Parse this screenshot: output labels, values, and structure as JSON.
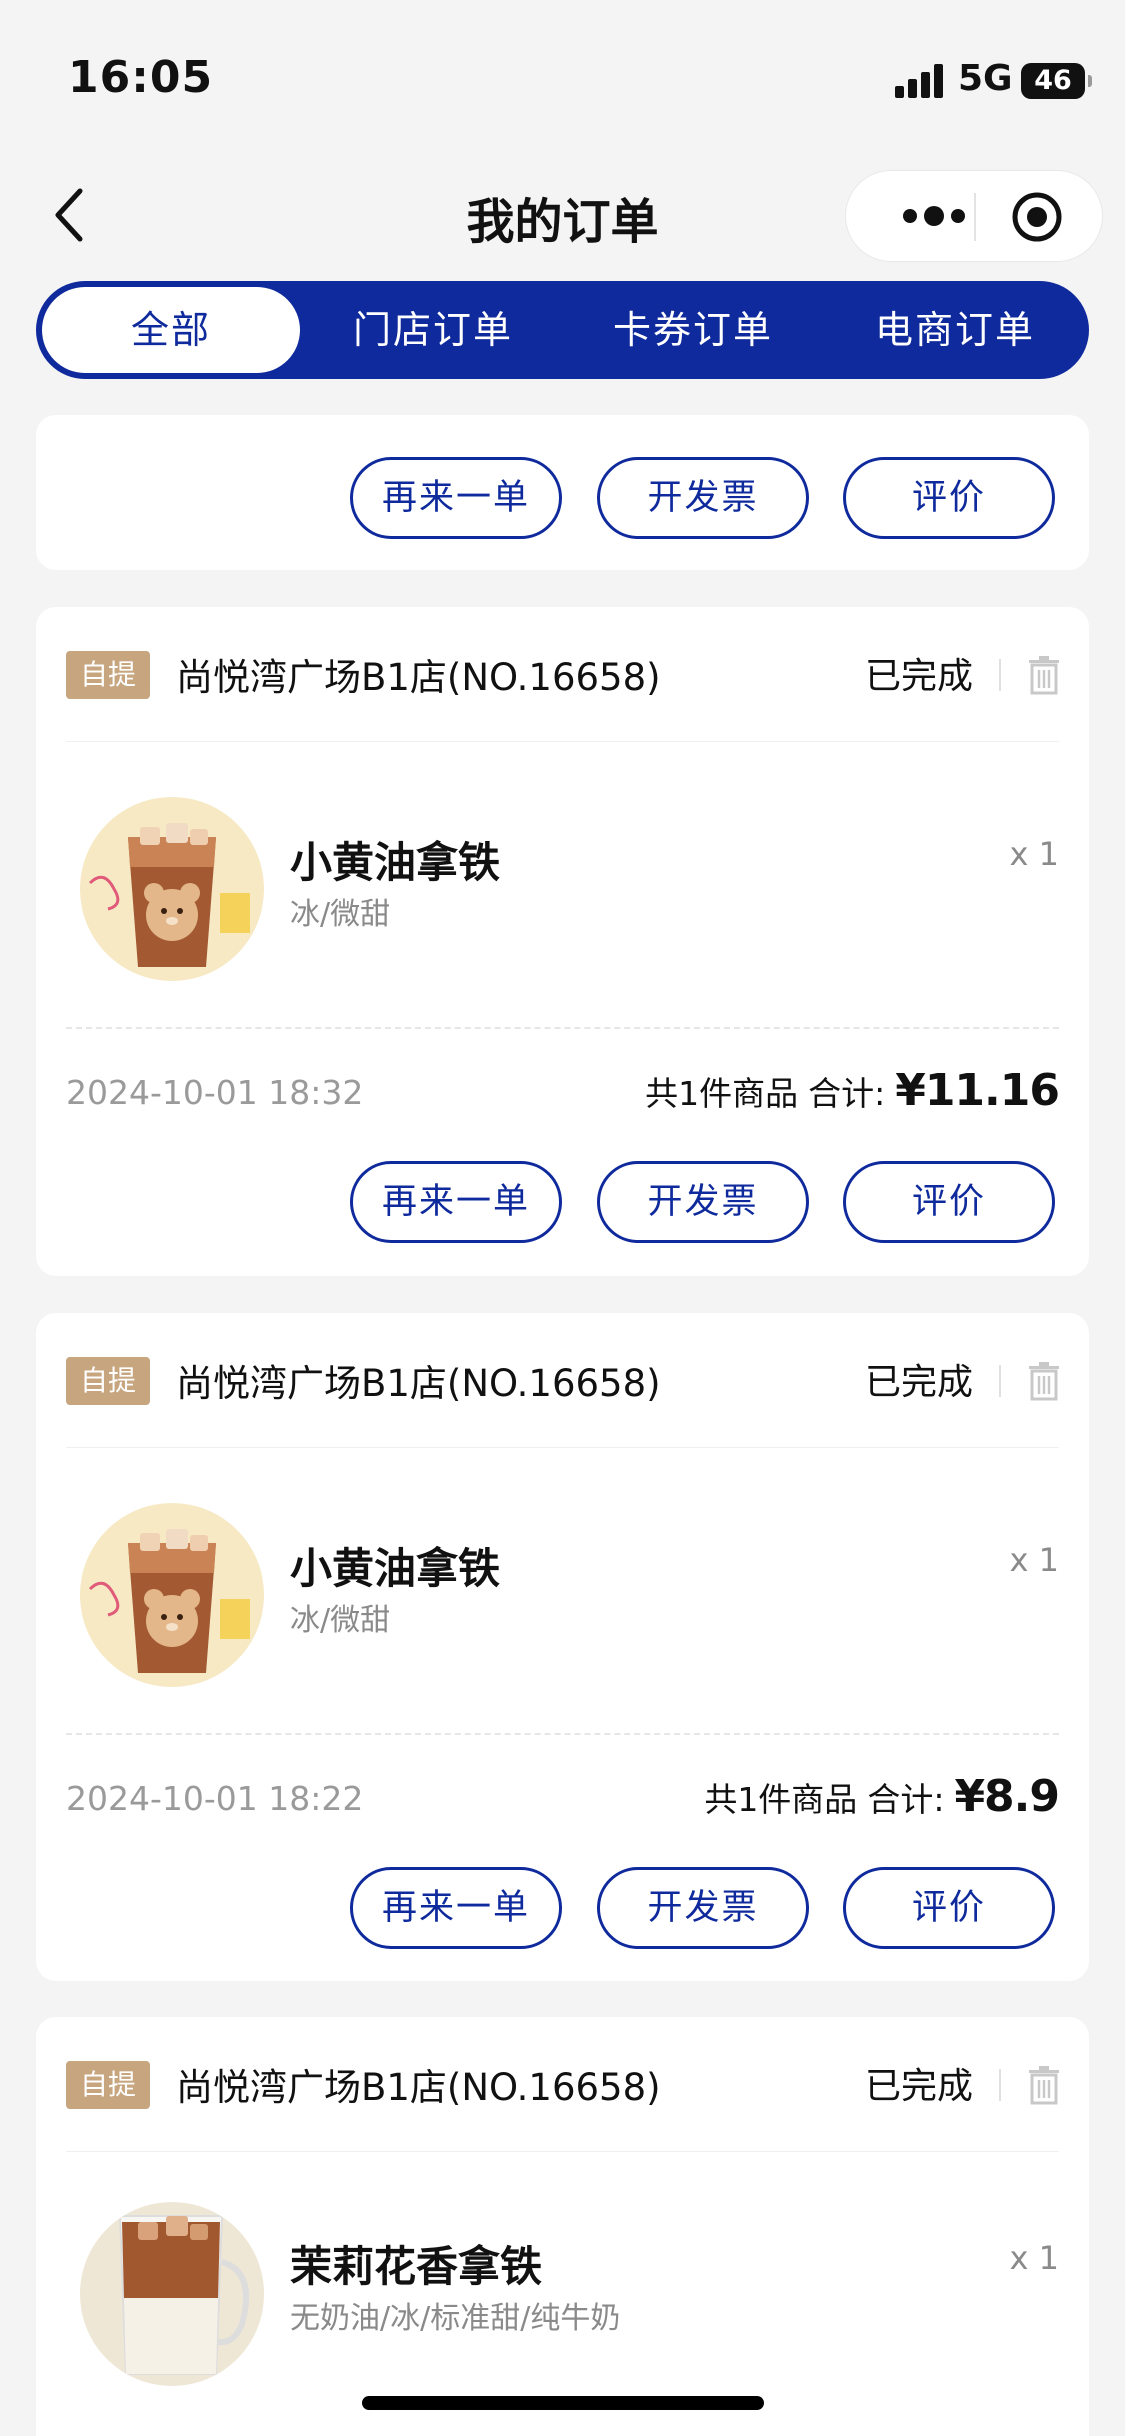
{
  "status_bar": {
    "time": "16:05",
    "network": "5G",
    "battery": "46"
  },
  "nav": {
    "title": "我的订单",
    "back_icon": "chevron-left-icon",
    "more_icon": "more-dots-icon",
    "close_icon": "target-circle-icon"
  },
  "tabs": [
    {
      "label": "全部",
      "active": true
    },
    {
      "label": "门店订单",
      "active": false
    },
    {
      "label": "卡券订单",
      "active": false
    },
    {
      "label": "电商订单",
      "active": false
    }
  ],
  "colors": {
    "primary": "#0f2a9c",
    "badge": "#c7a57f",
    "background": "#f4f4f4"
  },
  "actions": {
    "reorder": "再来一单",
    "invoice": "开发票",
    "review": "评价"
  },
  "orders": [
    {
      "badge": "自提",
      "store": "尚悦湾广场B1店(NO.16658)",
      "status": "已完成",
      "product": {
        "name": "小黄油拿铁",
        "spec": "冰/微甜",
        "qty": "x 1"
      },
      "time": "2024-10-01 18:32",
      "count_text": "共1件商品",
      "total_label": "合计:",
      "price": "¥11.16"
    },
    {
      "badge": "自提",
      "store": "尚悦湾广场B1店(NO.16658)",
      "status": "已完成",
      "product": {
        "name": "小黄油拿铁",
        "spec": "冰/微甜",
        "qty": "x 1"
      },
      "time": "2024-10-01 18:22",
      "count_text": "共1件商品",
      "total_label": "合计:",
      "price": "¥8.9"
    },
    {
      "badge": "自提",
      "store": "尚悦湾广场B1店(NO.16658)",
      "status": "已完成",
      "product": {
        "name": "茉莉花香拿铁",
        "spec": "无奶油/冰/标准甜/纯牛奶",
        "qty": "x 1"
      }
    }
  ]
}
